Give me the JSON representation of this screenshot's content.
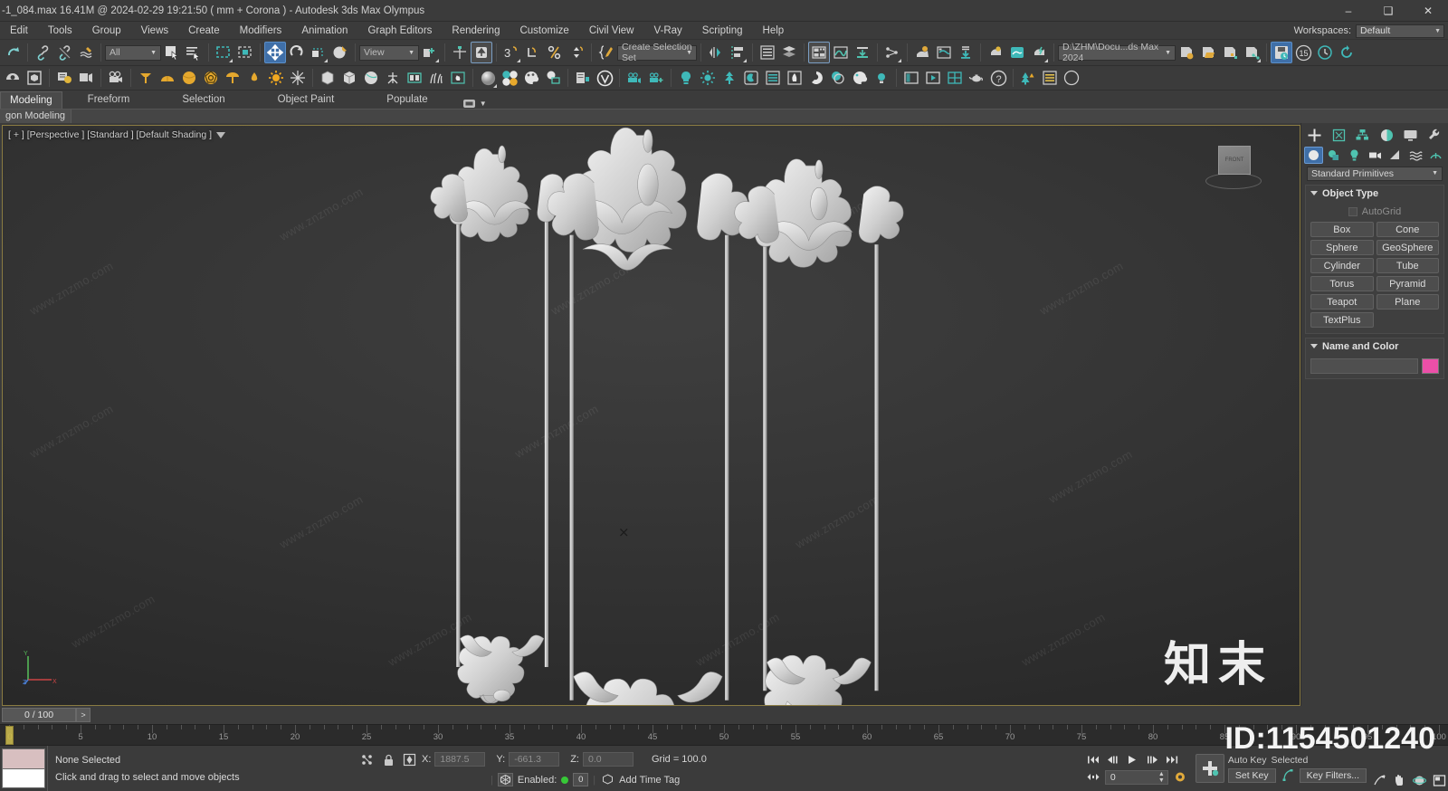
{
  "titlebar": {
    "title": "-1_084.max  16.41M @ 2024-02-29 19:21:50  ( mm + Corona ) - Autodesk 3ds Max Olympus",
    "minimize": "–",
    "maximize": "❑",
    "close": "✕"
  },
  "menubar": {
    "items": [
      "Edit",
      "Tools",
      "Group",
      "Views",
      "Create",
      "Modifiers",
      "Animation",
      "Graph Editors",
      "Rendering",
      "Customize",
      "Civil View",
      "V-Ray",
      "Scripting",
      "Help"
    ],
    "workspaces_label": "Workspaces:",
    "workspaces_value": "Default"
  },
  "toolbar": {
    "selection_filter": "All",
    "reference_coord": "View",
    "selection_set": "Create Selection Set",
    "project_path": "D:\\ZHM\\Docu...ds Max 2024",
    "autobackup_count": "15",
    "icons": [
      "redo-icon",
      "select-link-icon",
      "unlink-icon",
      "bind-space-warp-icon",
      "select-object-icon",
      "select-by-name-icon",
      "rect-selection-region-icon",
      "window-crossing-icon",
      "select-move-icon",
      "select-rotate-icon",
      "select-scale-icon",
      "place-icon",
      "ref-coord-icon",
      "use-pivot-center-icon",
      "snaps-toggle-icon",
      "select-and-manipulate-icon",
      "angle-snap-icon",
      "percent-snap-icon",
      "spinner-snap-icon",
      "named-selection-sets-icon",
      "mirror-icon",
      "align-icon",
      "layer-explorer-icon",
      "layer-manager-icon",
      "scene-explorer-icon",
      "curve-editor-icon",
      "schematic-view-icon",
      "material-editor-icon",
      "render-setup-icon",
      "render-frame-window-icon",
      "render-production-icon",
      "save-file-icon",
      "open-file-icon",
      "save-as-icon",
      "save-incremental-icon",
      "autosave-icon",
      "backup-count-icon",
      "history-icon",
      "refresh-icon"
    ]
  },
  "ribbon": {
    "tabs": [
      "Modeling",
      "Freeform",
      "Selection",
      "Object Paint",
      "Populate"
    ],
    "selected_tab": "Modeling",
    "subtab": "gon Modeling"
  },
  "viewport": {
    "label": "[ + ] [Perspective ] [Standard ] [Default Shading ]",
    "viewcube_label": "FRONT",
    "axis_x": "X",
    "axis_y": "Y",
    "axis_z": "Z"
  },
  "command_panel": {
    "tabs": [
      "create-tab-icon",
      "modify-tab-icon",
      "hierarchy-tab-icon",
      "motion-tab-icon",
      "display-tab-icon",
      "utilities-tab-icon"
    ],
    "subtabs": [
      "geometry-icon",
      "shapes-icon",
      "lights-icon",
      "cameras-icon",
      "helpers-icon",
      "space-warps-icon",
      "systems-icon"
    ],
    "category": "Standard Primitives",
    "object_type_title": "Object Type",
    "autogrid_label": "AutoGrid",
    "buttons": [
      "Box",
      "Cone",
      "Sphere",
      "GeoSphere",
      "Cylinder",
      "Tube",
      "Torus",
      "Pyramid",
      "Teapot",
      "Plane",
      "TextPlus"
    ],
    "name_color_title": "Name and Color",
    "color_swatch": "#ec4fa8"
  },
  "timeslider": {
    "frame_label": "0 / 100",
    "next_label": ">"
  },
  "trackbar": {
    "ticks": [
      0,
      5,
      10,
      15,
      20,
      25,
      30,
      35,
      40,
      45,
      50,
      55,
      60,
      65,
      70,
      75,
      80,
      85,
      90,
      95,
      100
    ],
    "current_frame": 0
  },
  "statusbar": {
    "selection_status": "None Selected",
    "prompt": "Click and drag to select and move objects",
    "x_label": "X:",
    "x_value": "1887.5",
    "y_label": "Y:",
    "y_value": "-661.3",
    "z_label": "Z:",
    "z_value": "0.0",
    "grid_label": "Grid = 100.0",
    "enabled_label": "Enabled:",
    "key_count": "0",
    "add_time_tag": "Add Time Tag",
    "auto_key": "Auto Key",
    "selected_label": "Selected",
    "set_key": "Set Key",
    "key_filters": "Key Filters...",
    "spinner_value": "0"
  },
  "watermarks": {
    "site": "www.znzmo.com",
    "brand": "知末",
    "id": "ID:1154501240"
  }
}
